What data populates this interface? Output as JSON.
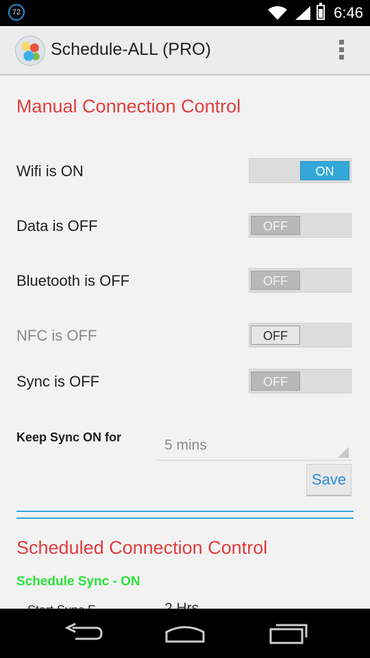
{
  "status_bar": {
    "notification_badge": "72",
    "time": "6:46",
    "icons": [
      "wifi-icon",
      "signal-icon",
      "battery-icon"
    ]
  },
  "action_bar": {
    "title": "Schedule-ALL (PRO)",
    "icons": [
      "app-icon",
      "overflow-menu-icon"
    ]
  },
  "manual": {
    "title": "Manual Connection Control",
    "rows": [
      {
        "label": "Wifi is ON",
        "state": "ON"
      },
      {
        "label": "Data is OFF",
        "state": "OFF"
      },
      {
        "label": "Bluetooth is OFF",
        "state": "OFF"
      },
      {
        "label": "NFC is OFF",
        "state": "OFF"
      },
      {
        "label": "Sync is OFF",
        "state": "OFF"
      }
    ],
    "keep_sync_label": "Keep Sync ON for",
    "keep_sync_value": "5 mins",
    "save_label": "Save"
  },
  "scheduled": {
    "title": "Scheduled Connection Control",
    "schedule_sync": "Schedule Sync - ON",
    "partial_label": "Start Sync E...",
    "partial_value": "2 Hrs"
  },
  "nav_bar": {
    "icons": [
      "back-icon",
      "home-icon",
      "recent-apps-icon"
    ]
  },
  "colors": {
    "accent_blue": "#33a8d8",
    "section_title_red": "#e03d3d",
    "schedule_green": "#29e33a"
  }
}
